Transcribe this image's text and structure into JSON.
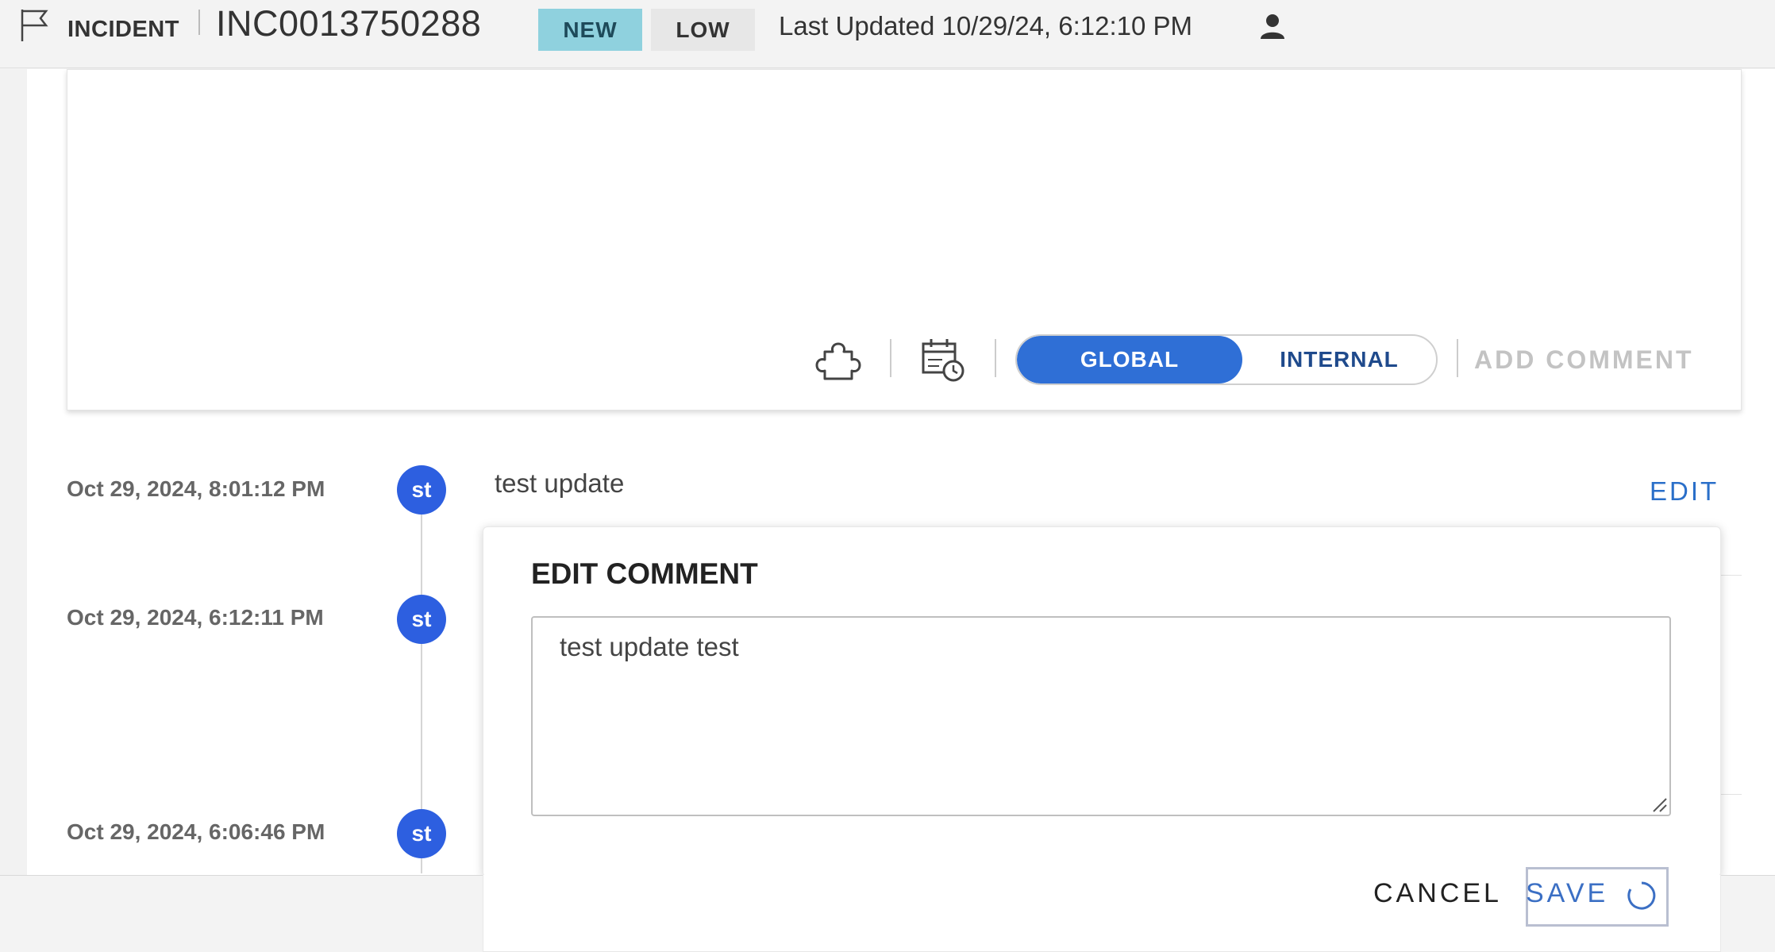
{
  "header": {
    "record_type": "INCIDENT",
    "number": "INC0013750288",
    "state_badge": "NEW",
    "priority_badge": "LOW",
    "last_updated": "Last Updated 10/29/24, 6:12:10 PM"
  },
  "compose": {
    "visibility_options": [
      "GLOBAL",
      "INTERNAL"
    ],
    "selected_visibility": "GLOBAL",
    "add_comment_label": "ADD COMMENT"
  },
  "timeline": {
    "entries": [
      {
        "time": "Oct 29, 2024, 8:01:12 PM",
        "avatar": "st",
        "text": "test update",
        "action": "EDIT"
      },
      {
        "time": "Oct 29, 2024, 6:12:11 PM",
        "avatar": "st"
      },
      {
        "time": "Oct 29, 2024, 6:06:46 PM",
        "avatar": "st"
      }
    ]
  },
  "edit_dialog": {
    "title": "EDIT COMMENT",
    "value": "test update test",
    "cancel_label": "CANCEL",
    "save_label": "SAVE"
  },
  "colors": {
    "accent": "#2f6fd6",
    "avatar": "#2d5fe0",
    "new_badge": "#8fd1de",
    "link": "#2a6fc9"
  },
  "icons": [
    "flag-icon",
    "user-icon",
    "puzzle-icon",
    "calendar-clock-icon",
    "resize-handle-icon",
    "spinner-icon"
  ]
}
